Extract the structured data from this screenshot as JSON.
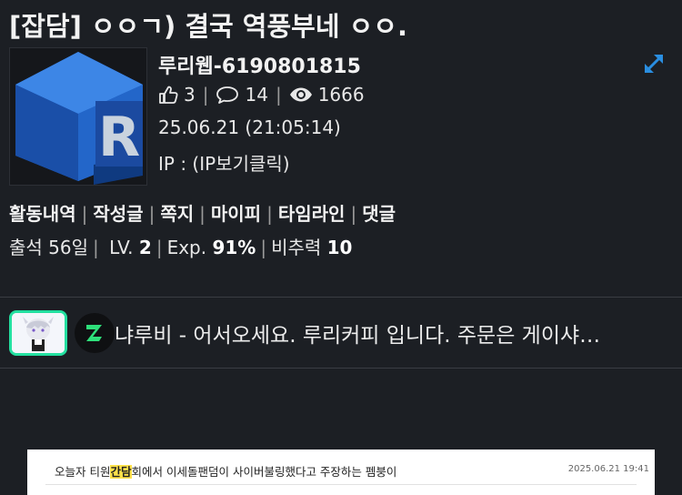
{
  "post": {
    "title": "[잡담] ㅇㅇㄱ) 결국 역풍부네 ㅇㅇ.",
    "author": "루리웹-6190801815",
    "likes": "3",
    "comments": "14",
    "views": "1666",
    "date": "25.06.21 (21:05:14)",
    "ip": "IP : (IP보기클릭)"
  },
  "profile_links": [
    "활동내역",
    "작성글",
    "쪽지",
    "마이피",
    "타임라인",
    "댓글"
  ],
  "profile_info": {
    "attendance": "출석 56일",
    "level_label": "LV.",
    "level": "2",
    "exp_label": "Exp.",
    "exp": "91%",
    "ratio_label": "비추력",
    "ratio": "10"
  },
  "comment_preview": {
    "text": "냐루비 - 어서오세요. 루리커피 입니다. 주문은 게이샤…"
  },
  "embed": {
    "title_pre": "오늘자 티원",
    "title_hl": "간담",
    "title_post": "회에서 이세돌팬덤이 사이버불링했다고 주장하는 펨붕이",
    "date": "2025.06.21 19:41"
  },
  "colors": {
    "background": "#1c1f24",
    "accent": "#2a8ee0",
    "avatar_border": "#23e0a0"
  },
  "icons": {
    "like": "thumbs-up-icon",
    "comment": "speech-bubble-icon",
    "view": "eye-icon",
    "expand": "expand-arrows-icon"
  }
}
